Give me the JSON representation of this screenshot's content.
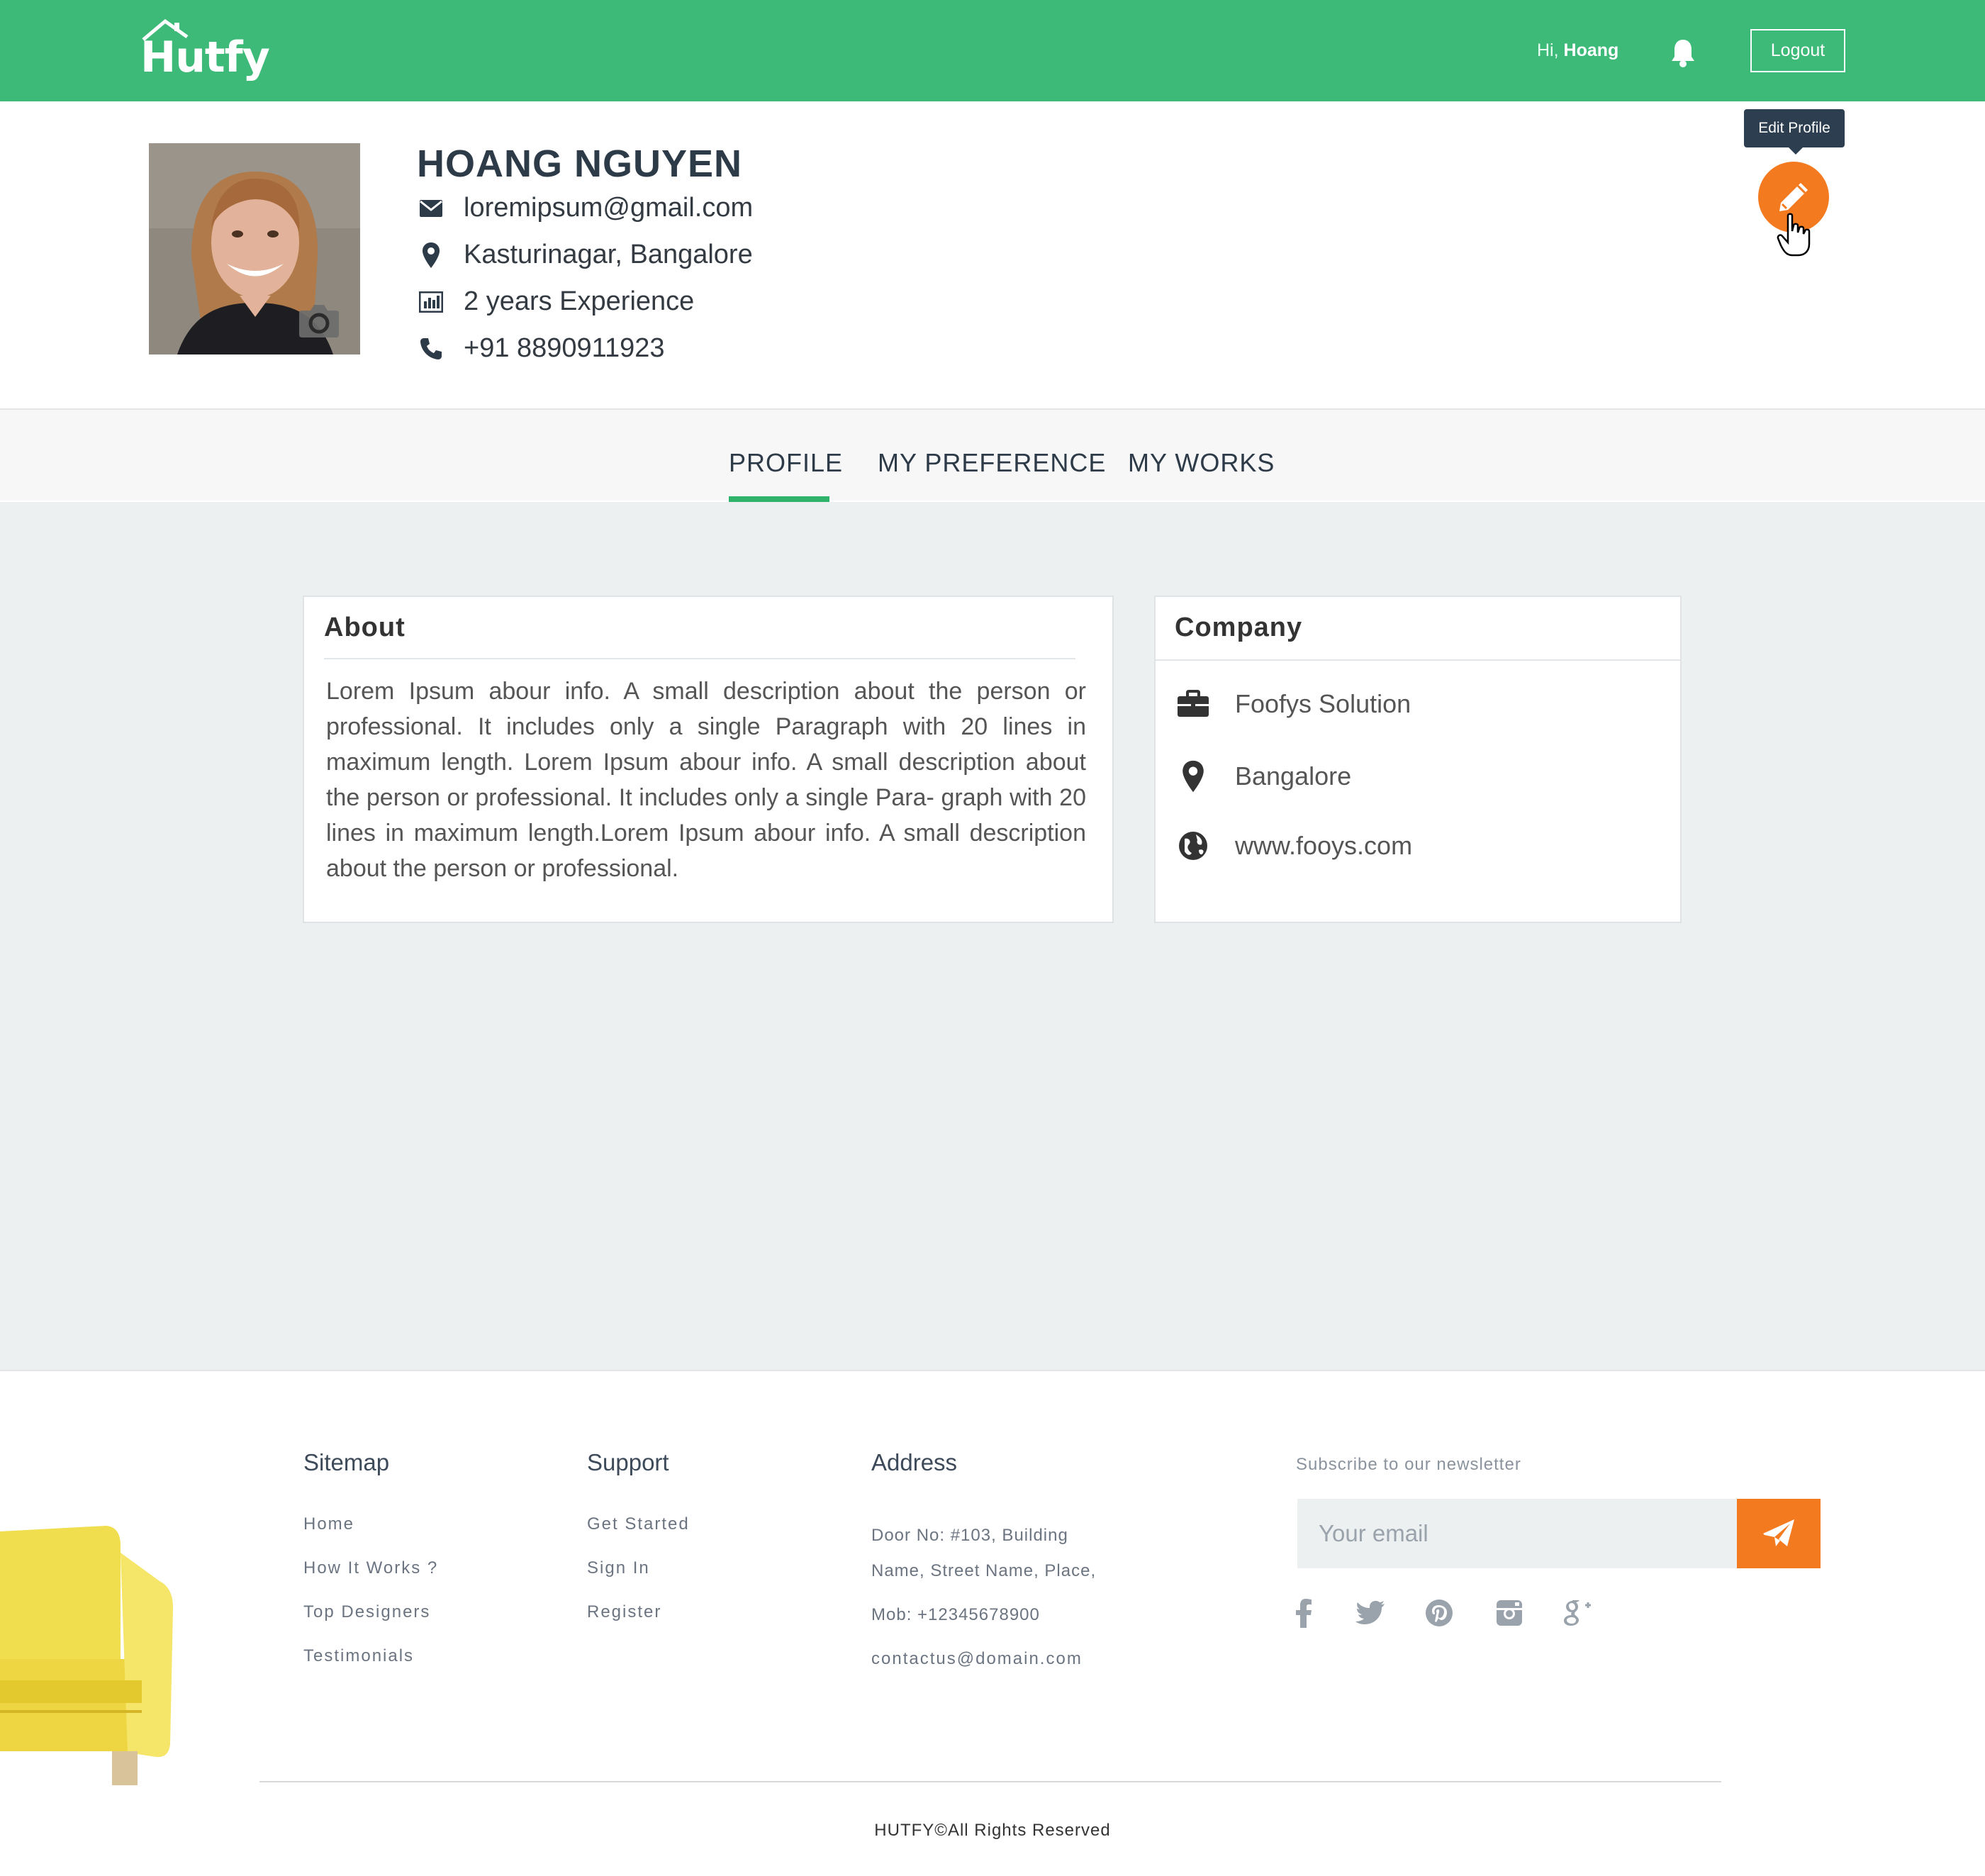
{
  "header": {
    "logo_text": "Hutfy",
    "greeting_prefix": "Hi,",
    "greeting_name": "Hoang",
    "logout_label": "Logout",
    "accent": "#3db978"
  },
  "profile": {
    "name": "HOANG NGUYEN",
    "email": "loremipsum@gmail.com",
    "location": "Kasturinagar, Bangalore",
    "experience": "2 years Experience",
    "phone": "+91 8890911923",
    "edit_tooltip": "Edit Profile"
  },
  "tabs": [
    {
      "label": "PROFILE",
      "active": true
    },
    {
      "label": "MY PREFERENCE",
      "active": false
    },
    {
      "label": "MY WORKS",
      "active": false
    }
  ],
  "about": {
    "title": "About",
    "text": "Lorem Ipsum abour info. A small description about the person or professional. It includes only a single Paragraph with 20 lines in maximum length. Lorem Ipsum abour info. A small description about the person or professional. It includes only a single Para- graph with 20 lines in maximum length.Lorem Ipsum abour info. A small description about the person or professional."
  },
  "company": {
    "title": "Company",
    "name": "Foofys Solution",
    "city": "Bangalore",
    "website": "www.fooys.com"
  },
  "footer": {
    "sitemap": {
      "title": "Sitemap",
      "links": [
        "Home",
        "How It Works ?",
        "Top Designers",
        "Testimonials"
      ]
    },
    "support": {
      "title": "Support",
      "links": [
        "Get Started",
        "Sign In",
        "Register"
      ]
    },
    "address": {
      "title": "Address",
      "line1": "Door No: #103, Building",
      "line2": "Name, Street Name, Place,",
      "mobile": "Mob: +12345678900",
      "email": "contactus@domain.com"
    },
    "newsletter": {
      "label": "Subscribe to our newsletter",
      "placeholder": "Your email"
    },
    "social_icons": [
      "facebook-icon",
      "twitter-icon",
      "pinterest-icon",
      "instagram-icon",
      "google-plus-icon"
    ],
    "copyright": "HUTFY©All Rights Reserved"
  },
  "colors": {
    "green": "#3db978",
    "orange": "#f47a20",
    "tab_underline": "#2fb36a",
    "dark_text": "#2d3a48"
  }
}
